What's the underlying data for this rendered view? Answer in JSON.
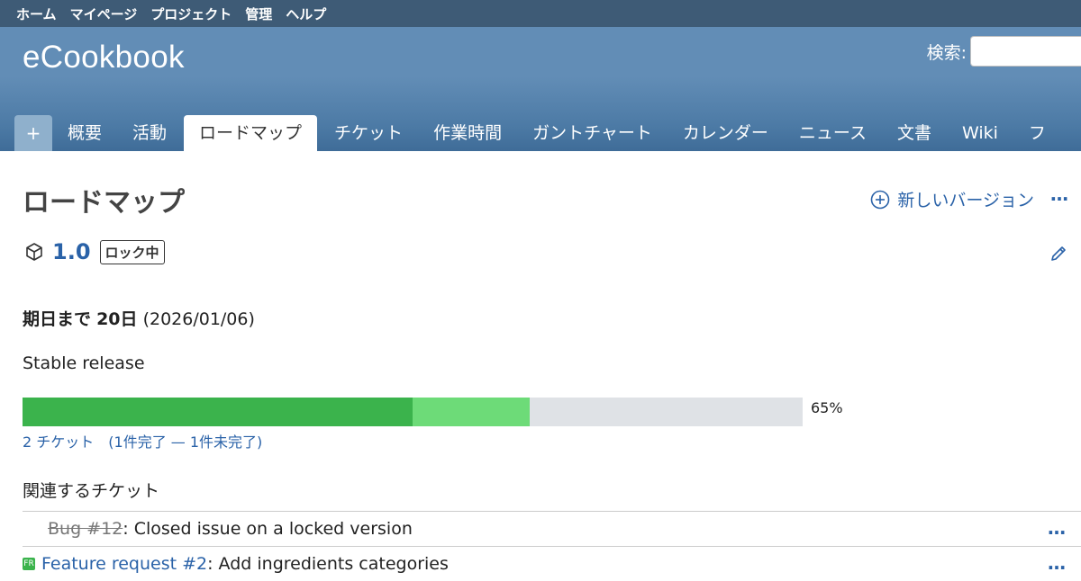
{
  "top_menu": [
    "ホーム",
    "マイページ",
    "プロジェクト",
    "管理",
    "ヘルプ"
  ],
  "header": {
    "project_title": "eCookbook",
    "search_label": "検索:"
  },
  "tabs": [
    {
      "label": "+"
    },
    {
      "label": "概要"
    },
    {
      "label": "活動"
    },
    {
      "label": "ロードマップ"
    },
    {
      "label": "チケット"
    },
    {
      "label": "作業時間"
    },
    {
      "label": "ガントチャート"
    },
    {
      "label": "カレンダー"
    },
    {
      "label": "ニュース"
    },
    {
      "label": "文書"
    },
    {
      "label": "Wiki"
    },
    {
      "label": "フ"
    }
  ],
  "page": {
    "title": "ロードマップ",
    "new_version_label": "新しいバージョン",
    "more": "…"
  },
  "version": {
    "name": "1.0",
    "status_badge": "ロック中",
    "due_prefix": "期日まで",
    "due_days": "20日",
    "due_date": "(2026/01/06)",
    "description": "Stable release",
    "progress": {
      "closed_fraction": 0.5,
      "done_fraction": 0.65,
      "percent_label": "65%"
    },
    "issue_counts": "2 チケット　(1件完了 — 1件未完了)"
  },
  "related": {
    "title": "関連するチケット",
    "issues": [
      {
        "link": "Bug #12",
        "subject": ": Closed issue on a locked version",
        "closed": true,
        "tracker_icon": ""
      },
      {
        "link": "Feature request #2",
        "subject": ": Add ingredients categories",
        "closed": false,
        "tracker_icon": "FR"
      }
    ]
  },
  "colors": {
    "header": "#628db6",
    "top_menu": "#3e5b76",
    "link": "#2a62a8",
    "progress_closed": "#3bb34c",
    "progress_done": "#6ddb78",
    "progress_todo": "#dfe2e6"
  },
  "icons": [
    "package-icon",
    "edit-pencil-icon",
    "add-circle-icon"
  ]
}
